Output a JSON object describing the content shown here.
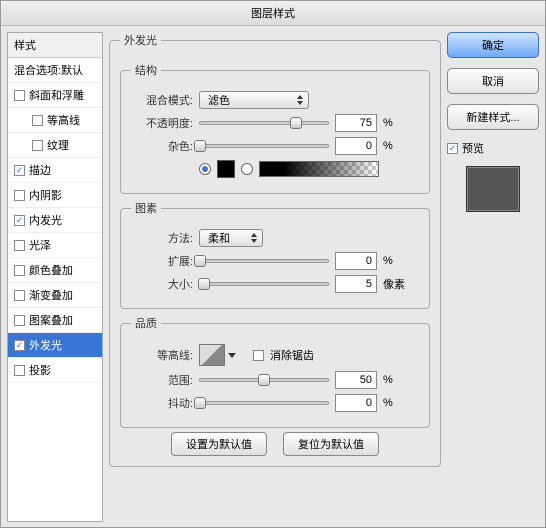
{
  "title": "图层样式",
  "styles": {
    "header": "样式",
    "blend_defaults": "混合选项:默认",
    "items": [
      {
        "label": "斜面和浮雕",
        "checked": false
      },
      {
        "label": "等高线",
        "checked": false,
        "indent": true
      },
      {
        "label": "纹理",
        "checked": false,
        "indent": true
      },
      {
        "label": "描边",
        "checked": true
      },
      {
        "label": "内阴影",
        "checked": false
      },
      {
        "label": "内发光",
        "checked": true
      },
      {
        "label": "光泽",
        "checked": false
      },
      {
        "label": "颜色叠加",
        "checked": false
      },
      {
        "label": "渐变叠加",
        "checked": false
      },
      {
        "label": "图案叠加",
        "checked": false
      },
      {
        "label": "外发光",
        "checked": true,
        "selected": true
      },
      {
        "label": "投影",
        "checked": false
      }
    ]
  },
  "panel": {
    "title": "外发光",
    "structure": {
      "legend": "结构",
      "blend_mode_label": "混合模式:",
      "blend_mode_value": "滤色",
      "opacity_label": "不透明度:",
      "opacity_value": "75",
      "opacity_unit": "%",
      "noise_label": "杂色:",
      "noise_value": "0",
      "noise_unit": "%"
    },
    "elements": {
      "legend": "图素",
      "technique_label": "方法:",
      "technique_value": "柔和",
      "spread_label": "扩展:",
      "spread_value": "0",
      "spread_unit": "%",
      "size_label": "大小:",
      "size_value": "5",
      "size_unit": "像素"
    },
    "quality": {
      "legend": "品质",
      "contour_label": "等高线:",
      "antialias_label": "消除锯齿",
      "range_label": "范围:",
      "range_value": "50",
      "range_unit": "%",
      "jitter_label": "抖动:",
      "jitter_value": "0",
      "jitter_unit": "%"
    },
    "set_default": "设置为默认值",
    "reset_default": "复位为默认值"
  },
  "buttons": {
    "ok": "确定",
    "cancel": "取消",
    "new_style": "新建样式...",
    "preview": "预览"
  },
  "colors": {
    "black": "#000000"
  }
}
